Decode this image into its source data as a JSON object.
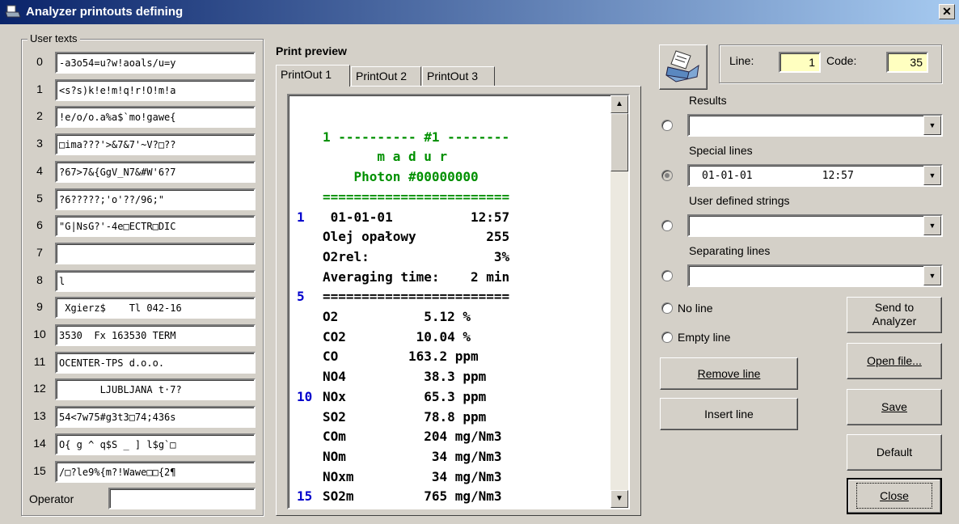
{
  "window": {
    "title": "Analyzer printouts defining",
    "close_glyph": "✕"
  },
  "user_texts": {
    "label": "User texts",
    "rows": [
      {
        "num": "0",
        "text": "-a3o54=u?w!aoals/u=y"
      },
      {
        "num": "1",
        "text": "<s?s)k!e!m!q!r!O!m!a"
      },
      {
        "num": "2",
        "text": "!e/o/o.a%a$`mo!gawe{"
      },
      {
        "num": "3",
        "text": "□ima???'>&7&7'~V?□??"
      },
      {
        "num": "4",
        "text": "?67>7&{GgV_N7&#W'6?7"
      },
      {
        "num": "5",
        "text": "?6?????;'o'??/96;\""
      },
      {
        "num": "6",
        "text": "\"G|NsG?'-4e□ECTR□DIC"
      },
      {
        "num": "7",
        "text": ""
      },
      {
        "num": "8",
        "text": "l"
      },
      {
        "num": "9",
        "text": " Xgierz$    Tl 042-16"
      },
      {
        "num": "10",
        "text": "3530  Fx 163530 TERM"
      },
      {
        "num": "11",
        "text": "OCENTER-TPS d.o.o."
      },
      {
        "num": "12",
        "text": "       LJUBLJANA t·7?"
      },
      {
        "num": "13",
        "text": "54<7w75#g3t3□74;436s"
      },
      {
        "num": "14",
        "text": "O{ g ^ q$S _ ] l$g`□"
      },
      {
        "num": "15",
        "text": "/□?le9%{m?!Wawe□□{2¶"
      }
    ],
    "operator_label": "Operator",
    "operator_value": ""
  },
  "preview": {
    "title": "Print preview",
    "tabs": [
      "PrintOut 1",
      "PrintOut 2",
      "PrintOut 3"
    ],
    "lines": [
      {
        "num": "",
        "text": "",
        "color": "black"
      },
      {
        "num": "",
        "text": "1 ---------- #1 --------",
        "color": "green"
      },
      {
        "num": "",
        "text": "       m a d u r",
        "color": "green"
      },
      {
        "num": "",
        "text": "    Photon #00000000",
        "color": "green"
      },
      {
        "num": "",
        "text": "========================",
        "color": "green"
      },
      {
        "num": "1",
        "text": " 01-01-01          12:57",
        "color": "black"
      },
      {
        "num": "",
        "text": "Olej opałowy         255",
        "color": "black"
      },
      {
        "num": "",
        "text": "O2rel:                3%",
        "color": "black"
      },
      {
        "num": "",
        "text": "Averaging time:    2 min",
        "color": "black"
      },
      {
        "num": "5",
        "text": "========================",
        "color": "black"
      },
      {
        "num": "",
        "text": "O2           5.12 %",
        "color": "black"
      },
      {
        "num": "",
        "text": "CO2         10.04 %",
        "color": "black"
      },
      {
        "num": "",
        "text": "CO         163.2 ppm",
        "color": "black"
      },
      {
        "num": "",
        "text": "NO4          38.3 ppm",
        "color": "black"
      },
      {
        "num": "10",
        "text": "NOx          65.3 ppm",
        "color": "black"
      },
      {
        "num": "",
        "text": "SO2          78.8 ppm",
        "color": "black"
      },
      {
        "num": "",
        "text": "COm          204 mg/Nm3",
        "color": "black"
      },
      {
        "num": "",
        "text": "NOm           34 mg/Nm3",
        "color": "black"
      },
      {
        "num": "",
        "text": "NOxm          34 mg/Nm3",
        "color": "black"
      },
      {
        "num": "15",
        "text": "SO2m         765 mg/Nm3",
        "color": "black"
      }
    ]
  },
  "line_code": {
    "line_label": "Line:",
    "line_value": "1",
    "code_label": "Code:",
    "code_value": "35"
  },
  "options": [
    {
      "label": "Results",
      "value": ""
    },
    {
      "label": "Special lines",
      "value": "01-01-01           12:57"
    },
    {
      "label": "User defined strings",
      "value": ""
    },
    {
      "label": "Separating lines",
      "value": ""
    }
  ],
  "radios": {
    "no_line": "No line",
    "empty_line": "Empty line"
  },
  "buttons": {
    "remove": "Remove line",
    "insert": "Insert line",
    "send_line1": "Send to",
    "send_line2": "Analyzer",
    "open": "Open file...",
    "save": "Save",
    "default": "Default",
    "close": "Close"
  },
  "icons": {
    "printer": "printer-icon",
    "app": "printer-app-icon"
  },
  "colors": {
    "title_start": "#0a246a",
    "title_end": "#a6caf0",
    "highlight": "#ffffc0",
    "green_text": "#009000",
    "blue_numbers": "#0000cc"
  }
}
